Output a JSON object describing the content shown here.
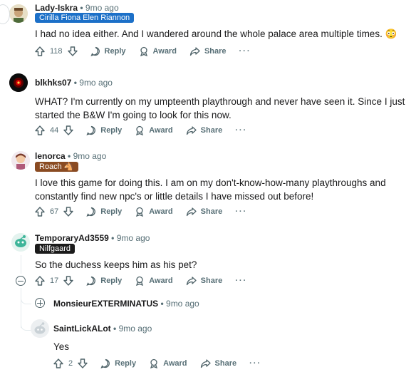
{
  "comments": [
    {
      "user": "Lady-Iskra",
      "time": "9mo ago",
      "flair": "Cirilla Fiona Elen Riannon",
      "flair_bg": "#1c70c8",
      "text": "I had no idea either. And I wandered around the whole palace area multiple times. 😳",
      "votes": "118"
    },
    {
      "user": "blkhks07",
      "time": "9mo ago",
      "text": "WHAT? I'm currently on my umpteenth playthrough and never have seen it. Since I just started the B&W I'm going to look for this now.",
      "votes": "44"
    },
    {
      "user": "lenorca",
      "time": "9mo ago",
      "flair": "Roach 🐴",
      "flair_bg": "#8a4b22",
      "text": "I love this game for doing this. I am on my don't-know-how-many playthroughs and constantly find new npc's or little details I have missed out before!",
      "votes": "67"
    },
    {
      "user": "TemporaryAd3559",
      "time": "9mo ago",
      "flair": "Nilfgaard",
      "flair_bg": "#1b1b1b",
      "text": "So the duchess keeps him as his pet?",
      "votes": "17"
    },
    {
      "user": "MonsieurEXTERMINATUS",
      "time": "9mo ago"
    },
    {
      "user": "SaintLickALot",
      "time": "9mo ago",
      "text": "Yes",
      "votes": "2"
    }
  ],
  "actions": {
    "reply": "Reply",
    "award": "Award",
    "share": "Share",
    "more": "···"
  },
  "separator": "•"
}
